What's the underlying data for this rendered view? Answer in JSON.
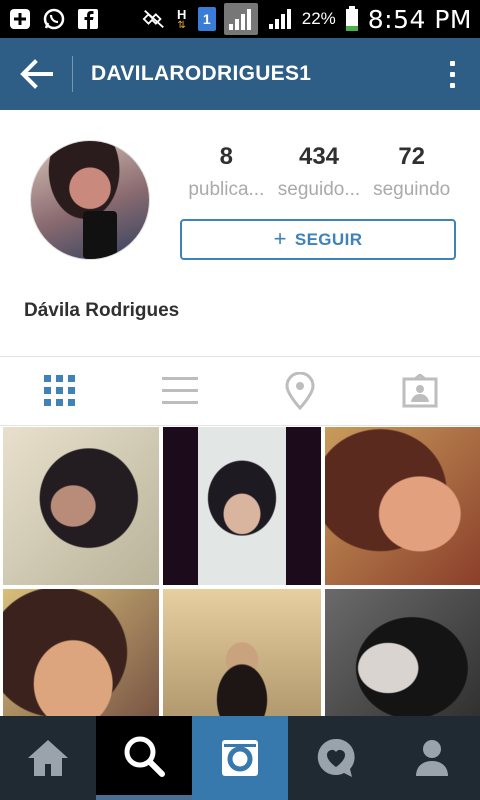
{
  "status_bar": {
    "time": "8:54 PM",
    "battery_percent": "22%",
    "sim_badge": "1",
    "net_letter": "H",
    "icons": [
      "add-box-icon",
      "whatsapp-icon",
      "facebook-icon",
      "mute-icon",
      "data-arrows-icon",
      "sim-icon",
      "signal-icon",
      "signal-icon",
      "battery-icon"
    ]
  },
  "header": {
    "title": "DAVILARODRIGUES1",
    "back_icon": "arrow-left-icon",
    "menu_icon": "overflow-menu-icon",
    "background": "#2e5e86"
  },
  "profile": {
    "stats": [
      {
        "value": "8",
        "label": "publica..."
      },
      {
        "value": "434",
        "label": "seguido..."
      },
      {
        "value": "72",
        "label": "seguindo"
      }
    ],
    "follow_label": "SEGUIR",
    "follow_icon": "plus-icon",
    "display_name": "Dávila Rodrigues",
    "accent": "#3e82b8"
  },
  "view_tabs": [
    {
      "icon": "grid-view-icon",
      "active": true
    },
    {
      "icon": "list-view-icon",
      "active": false
    },
    {
      "icon": "location-pin-icon",
      "active": false
    },
    {
      "icon": "tagged-photos-icon",
      "active": false
    }
  ],
  "photos": 6,
  "bottom_nav": [
    {
      "icon": "home-icon",
      "active": false
    },
    {
      "icon": "search-icon",
      "active": true
    },
    {
      "icon": "camera-icon",
      "active": false
    },
    {
      "icon": "activity-heart-icon",
      "active": false
    },
    {
      "icon": "profile-icon",
      "active": false
    }
  ]
}
